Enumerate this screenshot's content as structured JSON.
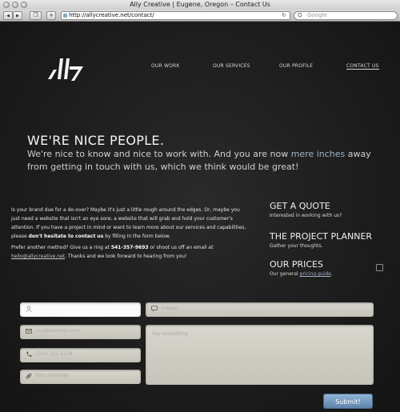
{
  "browser": {
    "window_title": "Ally Creative | Eugene, Oregon – Contact Us",
    "url": "http://allycreative.net/contact/",
    "search_placeholder": "Google",
    "add_button": "+",
    "reload_glyph": "↻",
    "search_glyph": "Q",
    "back_glyph": "◀",
    "forward_glyph": "▶",
    "bookmark_glyph": "❐"
  },
  "nav": {
    "items": [
      "OUR WORK",
      "OUR SERVICES",
      "OUR PROFILE",
      "CONTACT US"
    ],
    "active": "CONTACT US"
  },
  "hero": {
    "headline": "WE'RE NICE PEOPLE.",
    "lead_before": "We're nice to know and nice to work with. And you are now ",
    "lead_highlight": "mere inches",
    "lead_after": " away from getting in touch with us, which we think would be great!"
  },
  "body": {
    "p1_a": "Is your brand due for a do-over? Maybe it's just a little rough around the edges. Or, maybe you just need a website that isn't an eye sore; a website that will grab and hold your customer's attention. If you have a project in mind or want to learn more about our services and capabilities, please ",
    "p1_bold": "don't hesitate to contact us",
    "p1_b": " by filling in the form below.",
    "p2_a": "Prefer another method? Give us a ring at ",
    "p2_phone": "541-357-9693",
    "p2_b": " or shoot us off an email at ",
    "p2_email": "hello@allycreative.net",
    "p2_c": ". Thanks and we look forward to hearing from you!"
  },
  "sidebar": {
    "quote_heading": "GET A QUOTE",
    "quote_sub": "Interested in working with us?",
    "planner_heading": "THE PROJECT PLANNER",
    "planner_sub": "Gather your thoughts.",
    "prices_heading": "OUR PRICES",
    "prices_sub_before": "Our general ",
    "prices_link": "pricing guide",
    "prices_sub_after": "."
  },
  "form": {
    "email_placeholder": "you@address.com",
    "phone_placeholder": "(541) 555-1234",
    "url_placeholder": "http://website",
    "subject_placeholder": "Subject",
    "message_placeholder": "Say something",
    "submit_label": "Submit!"
  },
  "colors": {
    "background": "#1b1b1b",
    "accent_blue": "#9fb3c8",
    "field_bg": "#cfccc3",
    "submit_bg": "#6f94ba"
  }
}
